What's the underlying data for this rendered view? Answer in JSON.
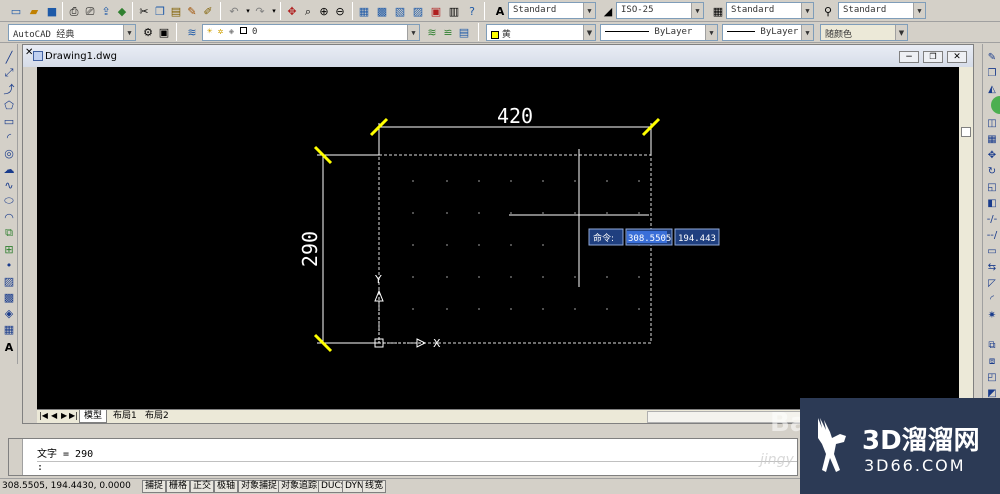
{
  "window": {
    "title": "Drawing1.dwg"
  },
  "toolbar1": {
    "text_style": "Standard",
    "dim_style": "ISO-25",
    "table_style": "Standard",
    "multileader_style": "Standard"
  },
  "toolbar2": {
    "workspace": "AutoCAD 经典",
    "layer": "0",
    "color": "黄",
    "linetype": "ByLayer",
    "lineweight": "ByLayer",
    "plotstyle": "随颜色"
  },
  "drawing": {
    "dim_horizontal": "420",
    "dim_vertical": "290",
    "axis_x": "X",
    "axis_y": "Y"
  },
  "dynamic_input": {
    "prompt": "命令:",
    "x_value": "308.5505",
    "y_value": "194.443"
  },
  "tabs": {
    "model": "模型",
    "layout1": "布局1",
    "layout2": "布局2"
  },
  "command_line": {
    "history_text": "文字 = 290",
    "prompt": ":"
  },
  "status_bar": {
    "coords": "308.5505, 194.4430, 0.0000",
    "buttons": [
      "捕捉",
      "栅格",
      "正交",
      "极轴",
      "对象捕捉",
      "对象追踪",
      "DUCS",
      "DYN",
      "线宽"
    ]
  },
  "watermark": {
    "brand": "3D溜溜网",
    "url": "3D66.COM",
    "overlay": "Bai",
    "overlay_url": "jingy"
  },
  "colors": {
    "canvas": "#000000",
    "extension_ticks": "#ffff00",
    "dynamic_input_bg": "#1f3f7f",
    "watermark_bg": "#2c3a55"
  }
}
